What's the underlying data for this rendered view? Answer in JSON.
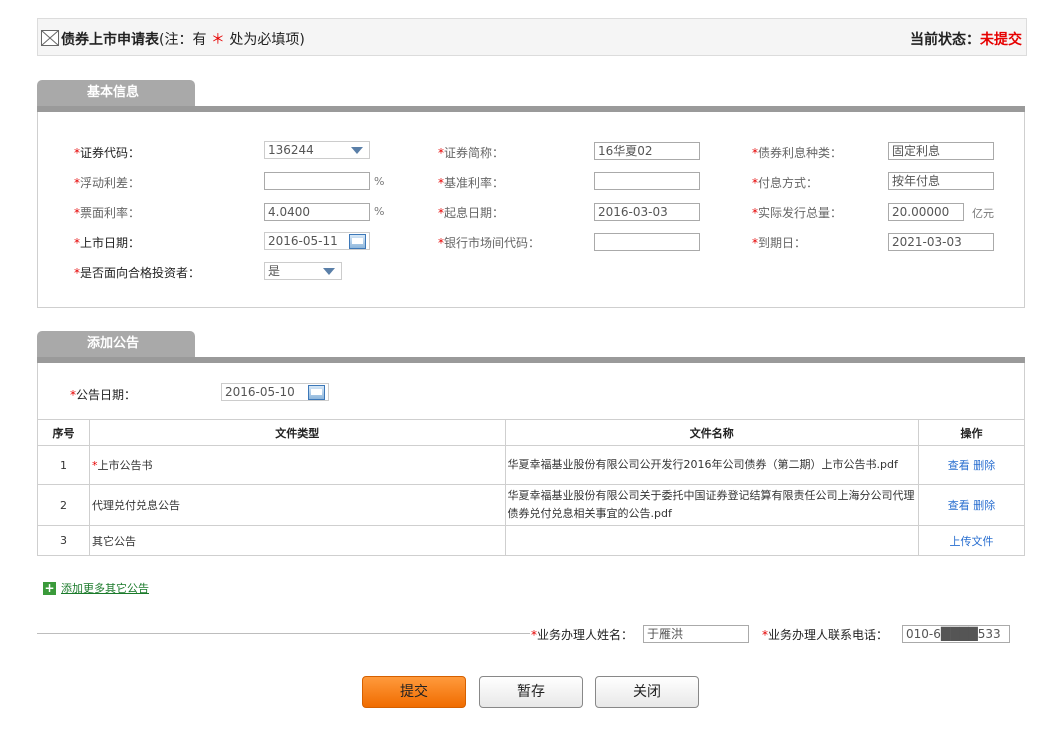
{
  "header": {
    "title": "债券上市申请表",
    "note_prefix": "(注：有",
    "note_star": "＊",
    "note_suffix": "处为必填项)",
    "status_label": "当前状态：",
    "status_value": "未提交"
  },
  "basic": {
    "tab_label": "基本信息",
    "fields": {
      "bond_code": {
        "label": "证券代码：",
        "value": "136244"
      },
      "bond_abbr": {
        "label": "证券简称：",
        "value": "16华夏02"
      },
      "rate_type": {
        "label": "债券利息种类：",
        "value": "固定利息"
      },
      "float_spread": {
        "label": "浮动利差：",
        "value": "",
        "unit": "%"
      },
      "base_rate": {
        "label": "基准利率：",
        "value": ""
      },
      "pay_method": {
        "label": "付息方式：",
        "value": "按年付息"
      },
      "coupon_rate": {
        "label": "票面利率：",
        "value": "4.0400",
        "unit": "%"
      },
      "value_date": {
        "label": "起息日期：",
        "value": "2016-03-03"
      },
      "issue_total": {
        "label": "实际发行总量：",
        "value": "20.00000",
        "unit": "亿元"
      },
      "listing_date": {
        "label": "上市日期：",
        "value": "2016-05-11"
      },
      "interbank_code": {
        "label": "银行市场间代码：",
        "value": ""
      },
      "maturity_date": {
        "label": "到期日：",
        "value": "2021-03-03"
      },
      "qualified_investors": {
        "label": "是否面向合格投资者：",
        "value": "是"
      }
    }
  },
  "announce": {
    "tab_label": "添加公告",
    "date_label": "公告日期：",
    "date_value": "2016-05-10",
    "columns": [
      "序号",
      "文件类型",
      "文件名称",
      "操作"
    ],
    "rows": [
      {
        "no": "1",
        "type": "上市公告书",
        "required": true,
        "name": "华夏幸福基业股份有限公司公开发行2016年公司债券（第二期）上市公告书.pdf",
        "actions": [
          "查看",
          "删除"
        ]
      },
      {
        "no": "2",
        "type": "代理兑付兑息公告",
        "required": false,
        "name": "华夏幸福基业股份有限公司关于委托中国证券登记结算有限责任公司上海分公司代理债券兑付兑息相关事宜的公告.pdf",
        "actions": [
          "查看",
          "删除"
        ]
      },
      {
        "no": "3",
        "type": "其它公告",
        "required": false,
        "name": "",
        "actions": [
          "上传文件"
        ]
      }
    ],
    "add_more": "添加更多其它公告"
  },
  "contact": {
    "name_label": "业务办理人姓名：",
    "name_value": "于雁洪",
    "phone_label": "业务办理人联系电话：",
    "phone_value": "010-6████533"
  },
  "buttons": {
    "submit": "提交",
    "save": "暂存",
    "close": "关闭"
  },
  "colors": {
    "required": "#e60000",
    "primary_button": "#f07a10",
    "tab_bg": "#a9a9a9",
    "link": "#2a6fd0"
  }
}
